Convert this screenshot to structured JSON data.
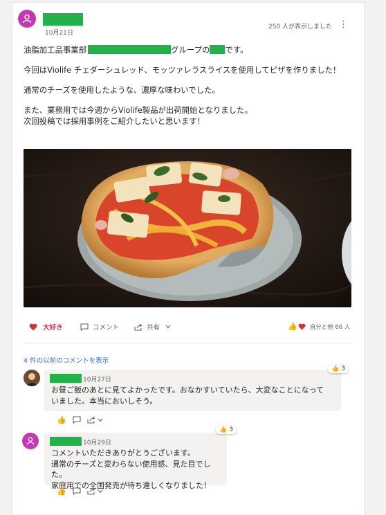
{
  "post": {
    "date": "10月21日",
    "views": "250 人が表示しました",
    "more": "⋮",
    "text": {
      "line1_prefix": "油脂加工品事業部",
      "line1_mid": "グループの",
      "line1_suffix": "です。",
      "para2": "今回はViolife チェダーシュレッド、モッツァレラスライスを使用してピザを作りました！",
      "para3": "通常のチーズを使用したような、濃厚な味わいでした。",
      "para4a": "また、業務用では今週からViolife製品が出荷開始となりました。",
      "para4b": "次回投稿では採用事例をご紹介したいと思います！"
    }
  },
  "actions": {
    "like_label": "大好き",
    "comment_label": "コメント",
    "share_label": "共有",
    "reaction_summary": "自分と他 66 人"
  },
  "comments": {
    "previous_link": "4 件の以前のコメントを表示",
    "items": [
      {
        "date": "10月27日",
        "text": "お昼ご飯のあとに見てよかったです。おなかすいていたら、大変なことになっていました。本当においしそう。",
        "reaction_count": "3"
      },
      {
        "date": "10月29日",
        "text_l1": "コメントいただきありがとうございます。",
        "text_l2": "通常のチーズと変わらない使用感、見た目でした。",
        "text_l3": "家庭用での全国発売が待ち遠しくなりました！",
        "reaction_count": "3"
      }
    ]
  },
  "colors": {
    "avatar": "#c239b3",
    "redaction": "#21b24b",
    "like_red": "#c4314b",
    "link_blue": "#2f6fbf",
    "thumb_yellow": "#f2b632"
  },
  "icons": [
    "person-icon",
    "more-icon",
    "heart-icon",
    "comment-icon",
    "share-icon",
    "chevron-down-icon",
    "thumbs-up-icon"
  ]
}
